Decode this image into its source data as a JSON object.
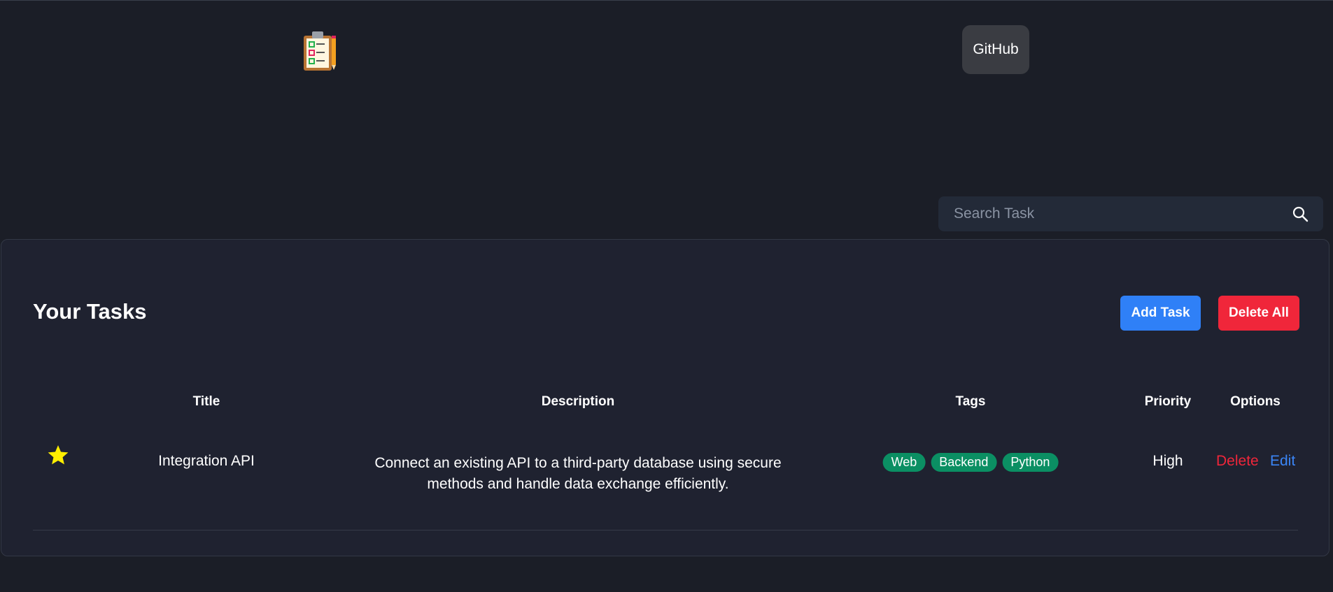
{
  "header": {
    "logo_icon": "clipboard-checklist-icon",
    "github_label": "GitHub"
  },
  "search": {
    "placeholder": "Search Task",
    "value": "",
    "icon": "search-icon"
  },
  "tasks": {
    "title": "Your Tasks",
    "add_label": "Add Task",
    "delete_all_label": "Delete All",
    "columns": {
      "title": "Title",
      "description": "Description",
      "tags": "Tags",
      "priority": "Priority",
      "options": "Options"
    },
    "rows": [
      {
        "starred": true,
        "star_icon": "star-icon",
        "star_color": "#ffee00",
        "title": "Integration API",
        "description": "Connect an existing API to a third-party database using secure methods and handle data exchange efficiently.",
        "tags": [
          "Web",
          "Backend",
          "Python"
        ],
        "priority": "High",
        "delete_label": "Delete",
        "edit_label": "Edit"
      }
    ]
  },
  "colors": {
    "background": "#1b1e27",
    "primary": "#2f80f7",
    "danger": "#f0263a",
    "tag": "#0b8f63"
  }
}
